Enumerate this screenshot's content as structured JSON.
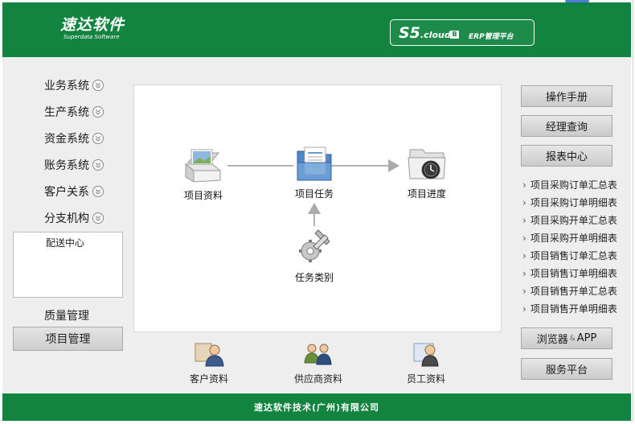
{
  "header": {
    "logo_main": "速达软件",
    "logo_sub": "Superdata Software",
    "product_s5": "S5",
    "product_cloud": ".cloud",
    "product_badge": "B",
    "product_text": "ERP管理平台",
    "brand_color": "#128440"
  },
  "sidebar": {
    "items": [
      {
        "label": "业务系统"
      },
      {
        "label": "生产系统"
      },
      {
        "label": "资金系统"
      },
      {
        "label": "账务系统"
      },
      {
        "label": "客户关系"
      },
      {
        "label": "分支机构"
      }
    ],
    "sub_items": [
      "配送中心"
    ],
    "quality": "质量管理",
    "active": "项目管理"
  },
  "flow": {
    "project_info": "项目资料",
    "project_task": "项目任务",
    "project_progress": "项目进度",
    "task_type": "任务类别"
  },
  "shortcuts": {
    "customer": "客户资料",
    "supplier": "供应商资料",
    "employee": "员工资料"
  },
  "right": {
    "manual": "操作手册",
    "manager_query": "经理查询",
    "report_center": "报表中心",
    "reports": [
      "项目采购订单汇总表",
      "项目采购订单明细表",
      "项目采购开单汇总表",
      "项目采购开单明细表",
      "项目销售订单汇总表",
      "项目销售订单明细表",
      "项目销售开单汇总表",
      "项目销售开单明细表"
    ],
    "browser": "浏览器",
    "amp": "&",
    "app": "APP",
    "service": "服务平台"
  },
  "footer": {
    "text": "速达软件技术(广州)有限公司"
  }
}
